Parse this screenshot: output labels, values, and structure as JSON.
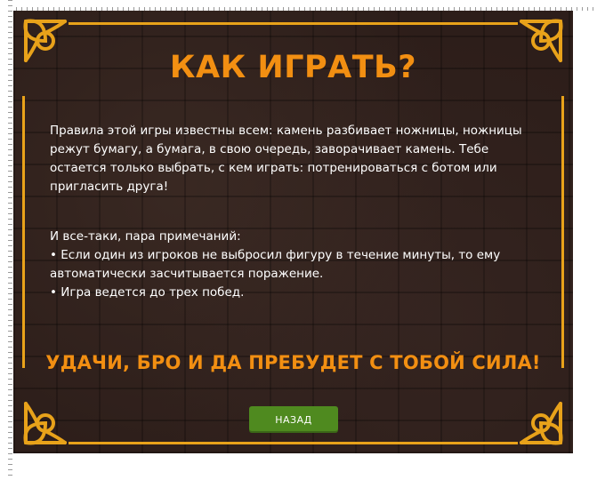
{
  "colors": {
    "panel_background": "#2d1e1a",
    "accent_orange": "#f28f12",
    "frame_gold": "#e8a21a",
    "button_green": "#4f8a1f",
    "text_white": "#ffffff"
  },
  "icons": {
    "corners": "celtic-knot-icon"
  },
  "how_to_play": {
    "title": "КАК ИГРАТЬ?",
    "rules_text": "Правила этой игры известны всем: камень разбивает ножницы, ножницы режут бумагу, а бумага, в свою очередь, заворачивает камень. Тебе остается только выбрать, с кем играть: потренироваться с ботом или пригласить друга!",
    "notes_heading": "И все-таки, пара примечаний:",
    "notes": [
      "• Если один из игроков не выбросил фигуру в течение минуты, то ему автоматически засчитывается поражение.",
      "• Игра ведется до трех побед."
    ],
    "farewell": "УДАЧИ, БРО И ДА ПРЕБУДЕТ С ТОБОЙ СИЛА!",
    "back_button_label": "НАЗАД"
  }
}
